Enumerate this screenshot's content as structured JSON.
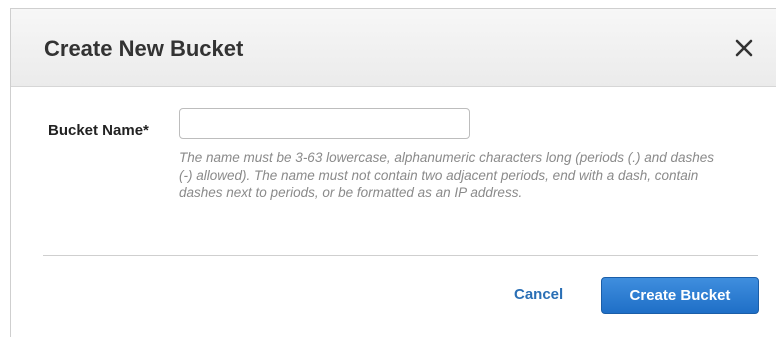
{
  "dialog": {
    "title": "Create New Bucket",
    "close_icon": "close-icon"
  },
  "form": {
    "bucket_name_label": "Bucket Name*",
    "bucket_name_value": "",
    "help_text": "The name must be 3-63 lowercase, alphanumeric characters long (periods (.) and dashes (-) allowed). The name must not contain two adjacent periods, end with a dash, contain dashes next to periods, or be formatted as an IP address."
  },
  "actions": {
    "cancel_label": "Cancel",
    "create_label": "Create Bucket"
  },
  "colors": {
    "primary_button": "#2574cc",
    "link": "#2a6fb5",
    "help_text": "#8a8a8a"
  }
}
